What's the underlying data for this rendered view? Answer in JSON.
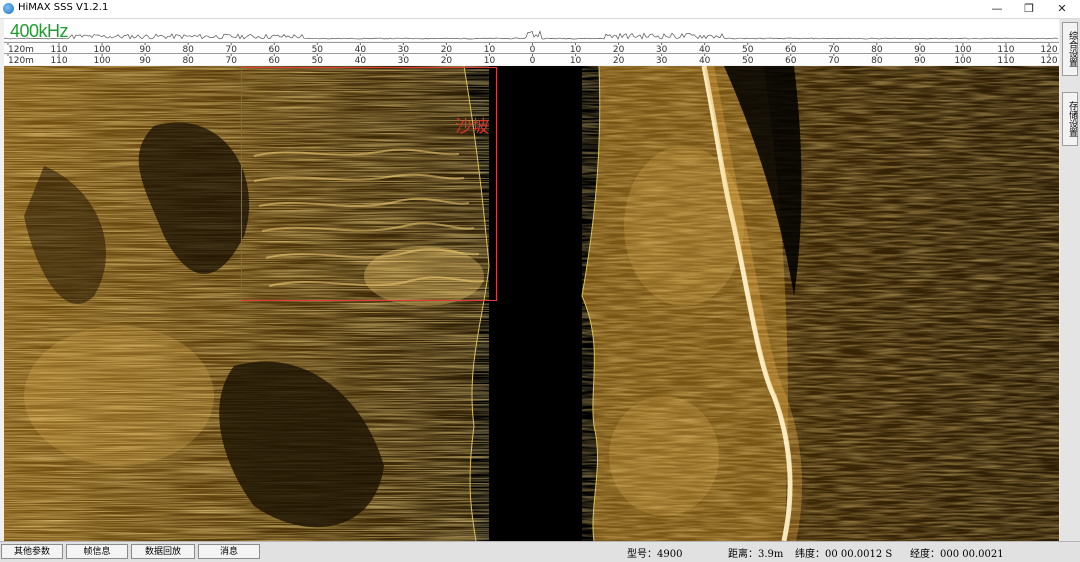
{
  "window": {
    "title": "HiMAX SSS V1.2.1"
  },
  "window_controls": {
    "minimize": "—",
    "maximize": "❐",
    "close": "✕"
  },
  "frequency_label": "400kHz",
  "range_scale": {
    "left_label": "120m",
    "ticks_left": [
      "110",
      "100",
      "90",
      "80",
      "70",
      "60",
      "50",
      "40",
      "30",
      "20",
      "10"
    ],
    "center": "0",
    "ticks_right": [
      "10",
      "20",
      "30",
      "40",
      "50",
      "60",
      "70",
      "80",
      "90",
      "100",
      "110",
      "120"
    ]
  },
  "annotation": {
    "label": "沙坡",
    "color": "#e03a3a"
  },
  "sidebar": {
    "settings_button": "综合设置",
    "storage_button": "存储设置"
  },
  "status_bar": {
    "buttons": [
      "其他参数",
      "帧信息",
      "数据回放",
      "消息"
    ],
    "model": "型号：4900",
    "altitude": "距离：3.9m",
    "latitude": "纬度：00 00.0012 S",
    "longitude": "经度：000 00.0021"
  },
  "colors": {
    "sonar_bright": "#f3c766",
    "sonar_mid": "#b8862a",
    "sonar_dark": "#3a2606",
    "ruler_text": "#333333"
  }
}
